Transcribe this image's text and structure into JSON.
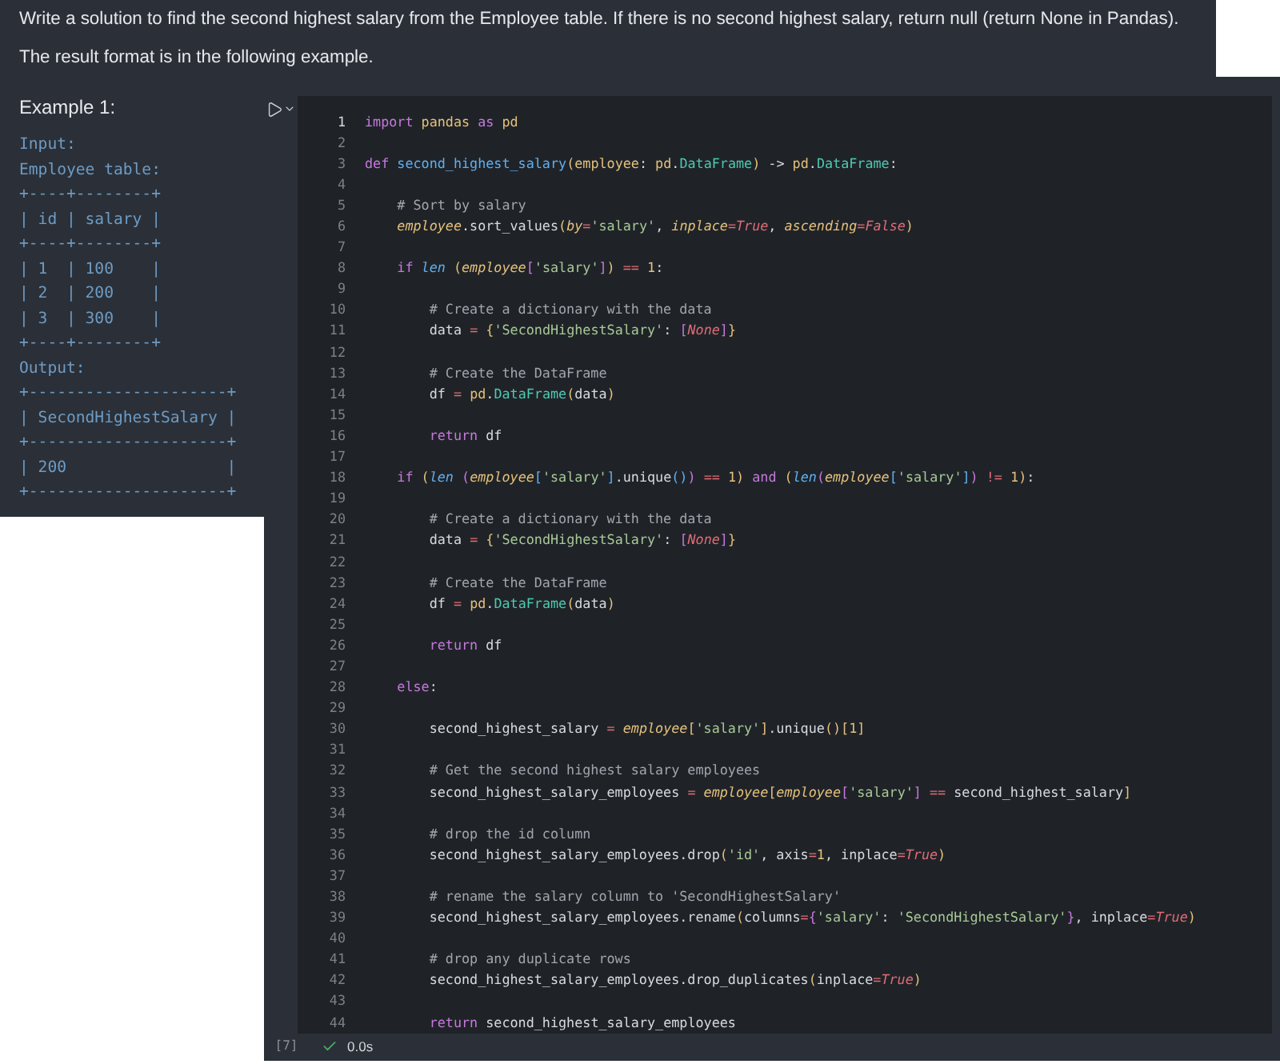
{
  "description": {
    "paragraphs": [
      "Write a solution to find the second highest salary from the Employee table. If there is no second highest salary, return null (return None in Pandas).",
      "The result format is in the following example."
    ]
  },
  "example": {
    "heading": "Example 1:",
    "lines": [
      "Input:",
      "Employee table:",
      "+----+--------+",
      "| id | salary |",
      "+----+--------+",
      "| 1  | 100    |",
      "| 2  | 200    |",
      "| 3  | 300    |",
      "+----+--------+",
      "Output:",
      "+---------------------+",
      "| SecondHighestSalary |",
      "+---------------------+",
      "| 200                 |",
      "+---------------------+"
    ]
  },
  "cell": {
    "execution_count": "[7]",
    "status": {
      "succeeded": true,
      "time": "0.0s"
    },
    "lines": [
      {
        "number": "1",
        "tokens": [
          {
            "kind": "keyword",
            "text": "import "
          },
          {
            "kind": "name",
            "text": "pandas "
          },
          {
            "kind": "keyword",
            "text": "as "
          },
          {
            "kind": "name",
            "text": "pd"
          }
        ]
      },
      {
        "number": "2"
      },
      {
        "number": "3",
        "tokens": [
          {
            "kind": "keyword",
            "text": "def "
          },
          {
            "kind": "function",
            "text": "second_highest_salary"
          },
          {
            "kind": "name",
            "text": "("
          },
          {
            "kind": "name",
            "text": "employee"
          },
          {
            "kind": "plain",
            "text": ": "
          },
          {
            "kind": "name",
            "text": "pd"
          },
          {
            "kind": "plain",
            "text": "."
          },
          {
            "kind": "class",
            "text": "DataFrame"
          },
          {
            "kind": "name",
            "text": ")"
          },
          {
            "kind": "plain",
            "text": " -> "
          },
          {
            "kind": "name",
            "text": "pd"
          },
          {
            "kind": "plain",
            "text": "."
          },
          {
            "kind": "class",
            "text": "DataFrame"
          },
          {
            "kind": "plain",
            "text": ":"
          }
        ]
      },
      {
        "number": "4"
      },
      {
        "number": "5",
        "tokens": [
          {
            "kind": "comment",
            "text": "    # Sort by salary"
          }
        ]
      },
      {
        "number": "6",
        "tokens": [
          {
            "kind": "param",
            "text": "    employee"
          },
          {
            "kind": "plain",
            "text": ".sort_values"
          },
          {
            "kind": "name",
            "text": "("
          },
          {
            "kind": "param",
            "text": "by"
          },
          {
            "kind": "operator",
            "text": "="
          },
          {
            "kind": "string",
            "text": "'salary'"
          },
          {
            "kind": "plain",
            "text": ", "
          },
          {
            "kind": "param",
            "text": "inplace"
          },
          {
            "kind": "operator",
            "text": "="
          },
          {
            "kind": "constant",
            "text": "True"
          },
          {
            "kind": "plain",
            "text": ", "
          },
          {
            "kind": "param",
            "text": "ascending"
          },
          {
            "kind": "operator",
            "text": "="
          },
          {
            "kind": "constant",
            "text": "False"
          },
          {
            "kind": "name",
            "text": ")"
          }
        ]
      },
      {
        "number": "7"
      },
      {
        "number": "8",
        "tokens": [
          {
            "kind": "keyword",
            "text": "    if "
          },
          {
            "kind": "builtin",
            "text": "len "
          },
          {
            "kind": "name",
            "text": "("
          },
          {
            "kind": "param",
            "text": "employee"
          },
          {
            "kind": "bracket",
            "text": "["
          },
          {
            "kind": "string",
            "text": "'salary'"
          },
          {
            "kind": "bracket",
            "text": "]"
          },
          {
            "kind": "name",
            "text": ") "
          },
          {
            "kind": "operator",
            "text": "== "
          },
          {
            "kind": "name",
            "text": "1"
          },
          {
            "kind": "plain",
            "text": ":"
          }
        ]
      },
      {
        "number": "9"
      },
      {
        "number": "10",
        "tokens": [
          {
            "kind": "comment",
            "text": "        # Create a dictionary with the data"
          }
        ]
      },
      {
        "number": "11",
        "tokens": [
          {
            "kind": "plain",
            "text": "        data "
          },
          {
            "kind": "operator",
            "text": "= "
          },
          {
            "kind": "name",
            "text": "{"
          },
          {
            "kind": "string",
            "text": "'SecondHighestSalary'"
          },
          {
            "kind": "plain",
            "text": ": "
          },
          {
            "kind": "bracket",
            "text": "["
          },
          {
            "kind": "constant",
            "text": "None"
          },
          {
            "kind": "bracket",
            "text": "]"
          },
          {
            "kind": "name",
            "text": "}"
          }
        ]
      },
      {
        "number": "12"
      },
      {
        "number": "13",
        "tokens": [
          {
            "kind": "comment",
            "text": "        # Create the DataFrame"
          }
        ]
      },
      {
        "number": "14",
        "tokens": [
          {
            "kind": "plain",
            "text": "        df "
          },
          {
            "kind": "operator",
            "text": "= "
          },
          {
            "kind": "name",
            "text": "pd"
          },
          {
            "kind": "plain",
            "text": "."
          },
          {
            "kind": "class",
            "text": "DataFrame"
          },
          {
            "kind": "name",
            "text": "("
          },
          {
            "kind": "plain",
            "text": "data"
          },
          {
            "kind": "name",
            "text": ")"
          }
        ]
      },
      {
        "number": "15"
      },
      {
        "number": "16",
        "tokens": [
          {
            "kind": "keyword",
            "text": "        return "
          },
          {
            "kind": "plain",
            "text": "df"
          }
        ]
      },
      {
        "number": "17"
      },
      {
        "number": "18",
        "tokens": [
          {
            "kind": "keyword",
            "text": "    if "
          },
          {
            "kind": "name",
            "text": "("
          },
          {
            "kind": "builtin",
            "text": "len "
          },
          {
            "kind": "bracket",
            "text": "("
          },
          {
            "kind": "param",
            "text": "employee"
          },
          {
            "kind": "nested",
            "text": "["
          },
          {
            "kind": "string",
            "text": "'salary'"
          },
          {
            "kind": "nested",
            "text": "]"
          },
          {
            "kind": "plain",
            "text": ".unique"
          },
          {
            "kind": "nested",
            "text": "()"
          },
          {
            "kind": "bracket",
            "text": ") "
          },
          {
            "kind": "operator",
            "text": "== "
          },
          {
            "kind": "name",
            "text": "1) "
          },
          {
            "kind": "keyword",
            "text": "and "
          },
          {
            "kind": "name",
            "text": "("
          },
          {
            "kind": "builtin",
            "text": "len"
          },
          {
            "kind": "bracket",
            "text": "("
          },
          {
            "kind": "param",
            "text": "employee"
          },
          {
            "kind": "nested",
            "text": "["
          },
          {
            "kind": "string",
            "text": "'salary'"
          },
          {
            "kind": "nested",
            "text": "]"
          },
          {
            "kind": "bracket",
            "text": ") "
          },
          {
            "kind": "operator",
            "text": "!= "
          },
          {
            "kind": "name",
            "text": "1)"
          },
          {
            "kind": "plain",
            "text": ":"
          }
        ]
      },
      {
        "number": "19"
      },
      {
        "number": "20",
        "tokens": [
          {
            "kind": "comment",
            "text": "        # Create a dictionary with the data"
          }
        ]
      },
      {
        "number": "21",
        "tokens": [
          {
            "kind": "plain",
            "text": "        data "
          },
          {
            "kind": "operator",
            "text": "= "
          },
          {
            "kind": "name",
            "text": "{"
          },
          {
            "kind": "string",
            "text": "'SecondHighestSalary'"
          },
          {
            "kind": "plain",
            "text": ": "
          },
          {
            "kind": "bracket",
            "text": "["
          },
          {
            "kind": "constant",
            "text": "None"
          },
          {
            "kind": "bracket",
            "text": "]"
          },
          {
            "kind": "name",
            "text": "}"
          }
        ]
      },
      {
        "number": "22"
      },
      {
        "number": "23",
        "tokens": [
          {
            "kind": "comment",
            "text": "        # Create the DataFrame"
          }
        ]
      },
      {
        "number": "24",
        "tokens": [
          {
            "kind": "plain",
            "text": "        df "
          },
          {
            "kind": "operator",
            "text": "= "
          },
          {
            "kind": "name",
            "text": "pd"
          },
          {
            "kind": "plain",
            "text": "."
          },
          {
            "kind": "class",
            "text": "DataFrame"
          },
          {
            "kind": "name",
            "text": "("
          },
          {
            "kind": "plain",
            "text": "data"
          },
          {
            "kind": "name",
            "text": ")"
          }
        ]
      },
      {
        "number": "25"
      },
      {
        "number": "26",
        "tokens": [
          {
            "kind": "keyword",
            "text": "        return "
          },
          {
            "kind": "plain",
            "text": "df"
          }
        ]
      },
      {
        "number": "27"
      },
      {
        "number": "28",
        "tokens": [
          {
            "kind": "keyword",
            "text": "    else"
          },
          {
            "kind": "plain",
            "text": ":"
          }
        ]
      },
      {
        "number": "29"
      },
      {
        "number": "30",
        "tokens": [
          {
            "kind": "plain",
            "text": "        second_highest_salary "
          },
          {
            "kind": "operator",
            "text": "= "
          },
          {
            "kind": "param",
            "text": "employee"
          },
          {
            "kind": "name",
            "text": "["
          },
          {
            "kind": "string",
            "text": "'salary'"
          },
          {
            "kind": "name",
            "text": "]"
          },
          {
            "kind": "plain",
            "text": ".unique"
          },
          {
            "kind": "name",
            "text": "()[1]"
          }
        ]
      },
      {
        "number": "31"
      },
      {
        "number": "32",
        "tokens": [
          {
            "kind": "comment",
            "text": "        # Get the second highest salary employees"
          }
        ]
      },
      {
        "number": "33",
        "tokens": [
          {
            "kind": "plain",
            "text": "        second_highest_salary_employees "
          },
          {
            "kind": "operator",
            "text": "= "
          },
          {
            "kind": "param",
            "text": "employee"
          },
          {
            "kind": "name",
            "text": "["
          },
          {
            "kind": "param",
            "text": "employee"
          },
          {
            "kind": "bracket",
            "text": "["
          },
          {
            "kind": "string",
            "text": "'salary'"
          },
          {
            "kind": "bracket",
            "text": "] "
          },
          {
            "kind": "operator",
            "text": "== "
          },
          {
            "kind": "plain",
            "text": "second_highest_salary"
          },
          {
            "kind": "name",
            "text": "]"
          }
        ]
      },
      {
        "number": "34"
      },
      {
        "number": "35",
        "tokens": [
          {
            "kind": "comment",
            "text": "        # drop the id column"
          }
        ]
      },
      {
        "number": "36",
        "tokens": [
          {
            "kind": "plain",
            "text": "        second_highest_salary_employees.drop"
          },
          {
            "kind": "name",
            "text": "("
          },
          {
            "kind": "string",
            "text": "'id'"
          },
          {
            "kind": "plain",
            "text": ", axis"
          },
          {
            "kind": "operator",
            "text": "="
          },
          {
            "kind": "name",
            "text": "1"
          },
          {
            "kind": "plain",
            "text": ", inplace"
          },
          {
            "kind": "operator",
            "text": "="
          },
          {
            "kind": "constant",
            "text": "True"
          },
          {
            "kind": "name",
            "text": ")"
          }
        ]
      },
      {
        "number": "37"
      },
      {
        "number": "38",
        "tokens": [
          {
            "kind": "comment",
            "text": "        # rename the salary column to 'SecondHighestSalary'"
          }
        ]
      },
      {
        "number": "39",
        "tokens": [
          {
            "kind": "plain",
            "text": "        second_highest_salary_employees.rename"
          },
          {
            "kind": "name",
            "text": "("
          },
          {
            "kind": "plain",
            "text": "columns"
          },
          {
            "kind": "operator",
            "text": "="
          },
          {
            "kind": "bracket",
            "text": "{"
          },
          {
            "kind": "string",
            "text": "'salary'"
          },
          {
            "kind": "plain",
            "text": ": "
          },
          {
            "kind": "string",
            "text": "'SecondHighestSalary'"
          },
          {
            "kind": "bracket",
            "text": "}"
          },
          {
            "kind": "plain",
            "text": ", inplace"
          },
          {
            "kind": "operator",
            "text": "="
          },
          {
            "kind": "constant",
            "text": "True"
          },
          {
            "kind": "name",
            "text": ")"
          }
        ]
      },
      {
        "number": "40"
      },
      {
        "number": "41",
        "tokens": [
          {
            "kind": "comment",
            "text": "        # drop any duplicate rows"
          }
        ]
      },
      {
        "number": "42",
        "tokens": [
          {
            "kind": "plain",
            "text": "        second_highest_salary_employees.drop_duplicates"
          },
          {
            "kind": "name",
            "text": "("
          },
          {
            "kind": "plain",
            "text": "inplace"
          },
          {
            "kind": "operator",
            "text": "="
          },
          {
            "kind": "constant",
            "text": "True"
          },
          {
            "kind": "name",
            "text": ")"
          }
        ]
      },
      {
        "number": "43"
      },
      {
        "number": "44",
        "tokens": [
          {
            "kind": "keyword",
            "text": "        return "
          },
          {
            "kind": "plain",
            "text": "second_highest_salary_employees"
          }
        ]
      }
    ]
  }
}
